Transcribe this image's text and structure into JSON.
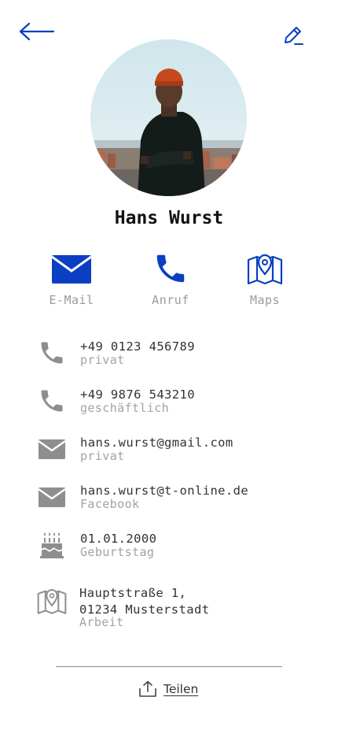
{
  "header": {
    "back_icon": "arrow-left-icon",
    "edit_icon": "pencil-icon"
  },
  "profile": {
    "name": "Hans Wurst"
  },
  "actions": [
    {
      "label": "E-Mail",
      "icon": "envelope-icon"
    },
    {
      "label": "Anruf",
      "icon": "phone-icon"
    },
    {
      "label": "Maps",
      "icon": "map-pin-icon"
    }
  ],
  "details": [
    {
      "icon": "phone-icon",
      "value": "+49 0123 456789",
      "type": "privat"
    },
    {
      "icon": "phone-icon",
      "value": "+49 9876 543210",
      "type": "geschäftlich"
    },
    {
      "icon": "envelope-icon",
      "value": "hans.wurst@gmail.com",
      "type": "privat"
    },
    {
      "icon": "envelope-icon",
      "value": "hans.wurst@t-online.de",
      "type": "Facebook"
    },
    {
      "icon": "birthday-cake-icon",
      "value": "01.01.2000",
      "type": "Geburtstag"
    },
    {
      "icon": "map-icon",
      "value": "Hauptstraße 1,\n01234 Musterstadt",
      "type": "Arbeit"
    }
  ],
  "share": {
    "label": "Teilen",
    "icon": "share-upload-icon"
  },
  "colors": {
    "accent": "#0a3fc4",
    "icon_gray": "#8e8e8e",
    "sub_text": "#a3a3a3"
  }
}
